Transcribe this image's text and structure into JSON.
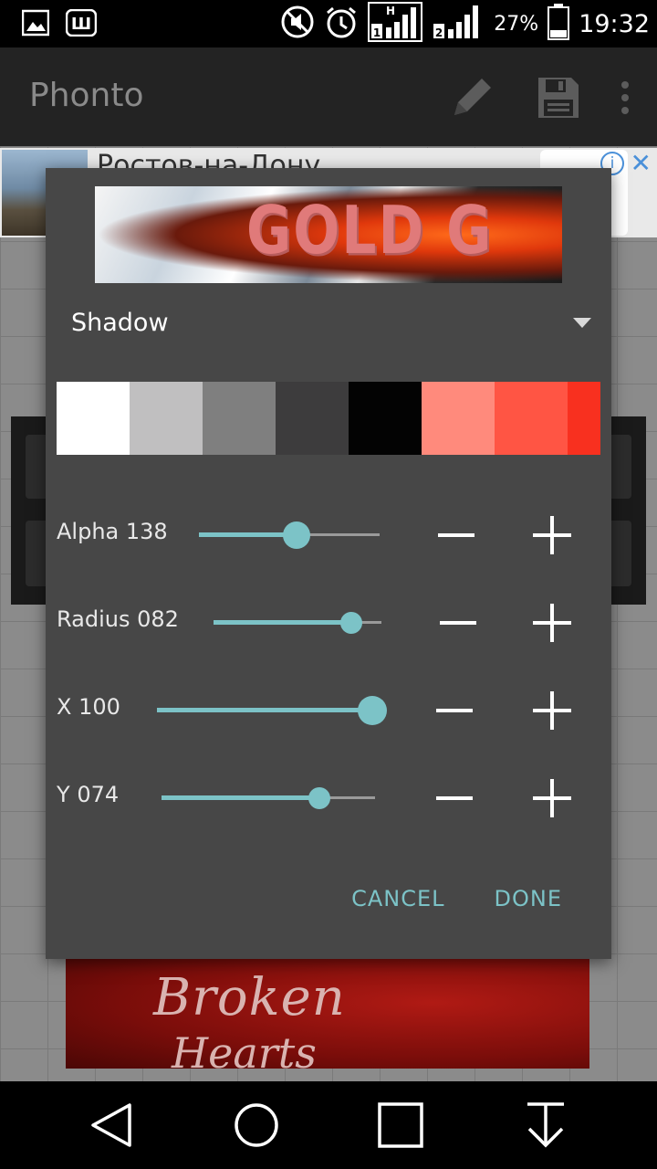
{
  "status_bar": {
    "left_icons": [
      "gallery-icon",
      "w-app-icon"
    ],
    "right_icons": [
      "mute-icon",
      "alarm-icon",
      "sim1-signal-icon",
      "sim2-signal-icon",
      "battery-icon"
    ],
    "sim1_label": "1",
    "sim1_network": "H",
    "sim2_label": "2",
    "battery": "27%",
    "time": "19:32"
  },
  "app_bar": {
    "title": "Phonto",
    "icons": [
      "pencil-icon",
      "save-icon",
      "overflow-menu-icon"
    ]
  },
  "background": {
    "ad_text": "Ростов-на-Дону",
    "ad_info": "i",
    "ad_close": "✕",
    "poster_line1": "Broken",
    "poster_line2": "Hearts"
  },
  "dialog": {
    "preview_text": "GOLD G",
    "mode_label": "Shadow",
    "swatch_colors": [
      "#ffffff",
      "#c0bfc0",
      "#7f7f7f",
      "#3d3c3d",
      "#030303",
      "#ff8a7c",
      "#ff5544",
      "#f8301f"
    ],
    "sliders": [
      {
        "name": "Alpha",
        "value": "138",
        "level": 0.54
      },
      {
        "name": "Radius",
        "value": "082",
        "level": 0.82
      },
      {
        "name": "X",
        "value": "100",
        "level": 1.0
      },
      {
        "name": "Y",
        "value": "074",
        "level": 0.74
      }
    ],
    "cancel_label": "CANCEL",
    "done_label": "DONE"
  },
  "nav_bar": {
    "icons": [
      "back-icon",
      "home-icon",
      "recents-icon",
      "download-icon"
    ]
  }
}
